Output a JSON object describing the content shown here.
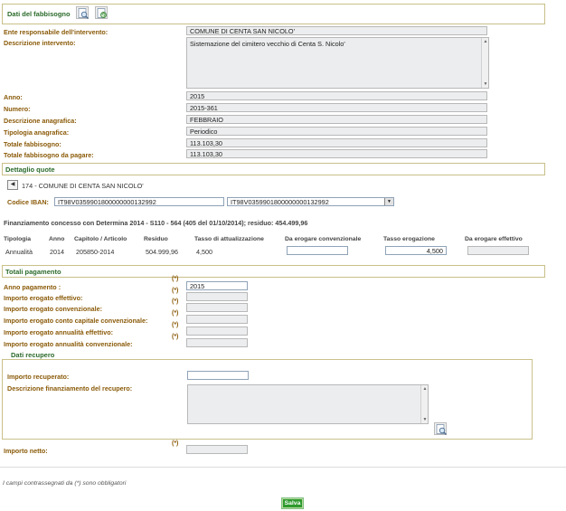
{
  "dati_fabbisogno": {
    "title": "Dati del fabbisogno",
    "fields": {
      "ente_label": "Ente responsabile dell'intervento:",
      "ente_value": "COMUNE DI CENTA SAN NICOLO'",
      "descrizione_label": "Descrizione intervento:",
      "descrizione_value": "Sistemazione del cimitero vecchio di Centa S. Nicolo'",
      "anno_label": "Anno:",
      "anno_value": "2015",
      "numero_label": "Numero:",
      "numero_value": "2015-361",
      "desc_anagrafica_label": "Descrizione anagrafica:",
      "desc_anagrafica_value": "FEBBRAIO",
      "tipologia_label": "Tipologia anagrafica:",
      "tipologia_value": "Periodico",
      "totale_label": "Totale fabbisogno:",
      "totale_value": "113.103,30",
      "totale_pagare_label": "Totale fabbisogno da pagare:",
      "totale_pagare_value": "113.103,30"
    }
  },
  "dettaglio_quote": {
    "title": "Dettaglio quote",
    "ente_entry": "174 - COMUNE DI CENTA SAN NICOLO'",
    "iban_label": "Codice IBAN:",
    "iban_input": "IT98V0359901800000000132992",
    "iban_select": "IT98V0359901800000000132992",
    "finanziamento": "Finanziamento concesso con Determina 2014 - S110 - 564 (405 del 01/10/2014); residuo: 454.499,96",
    "table": {
      "headers": [
        "Tipologia",
        "Anno",
        "Capitolo / Articolo",
        "Residuo",
        "Tasso di attualizzazione",
        "Da erogare convenzionale",
        "Tasso erogazione",
        "Da erogare effettivo"
      ],
      "row": {
        "tipologia": "Annualità",
        "anno": "2014",
        "capitolo": "205850-2014",
        "residuo": "504.999,96",
        "tasso_att": "4,500",
        "da_erogare_conv": "",
        "tasso_erog": "4,500",
        "da_erogare_eff": ""
      }
    }
  },
  "totali_pagamento": {
    "title": "Totali pagamento",
    "required_mark": "(*)",
    "anno_label": "Anno pagamento :",
    "anno_value": "2015",
    "imp_eff_label": "Importo erogato effettivo:",
    "imp_conv_label": "Importo erogato convenzionale:",
    "imp_conto_label": "Importo erogato conto capitale convenzionale:",
    "imp_ann_eff_label": "Importo erogato annualità effettivo:",
    "imp_ann_conv_label": "Importo erogato annualità convenzionale:"
  },
  "dati_recupero": {
    "title": "Dati recupero",
    "importo_label": "Importo recuperato:",
    "descrizione_label": "Descrizione finanziamento del recupero:"
  },
  "importo_netto_label": "Importo netto:",
  "footer_note": "I campi contrassegnati da (*) sono obbligatori",
  "salva_label": "Salva",
  "icons": {
    "detail_icon": "magnifier-document-icon",
    "refresh_icon": "refresh-document-icon",
    "search_icon": "magnifier-document-icon"
  },
  "colors": {
    "section_title": "#2b6a2b",
    "label": "#8a5a08",
    "section_border": "#c9c089",
    "salva_button": "#2e9a2e"
  }
}
